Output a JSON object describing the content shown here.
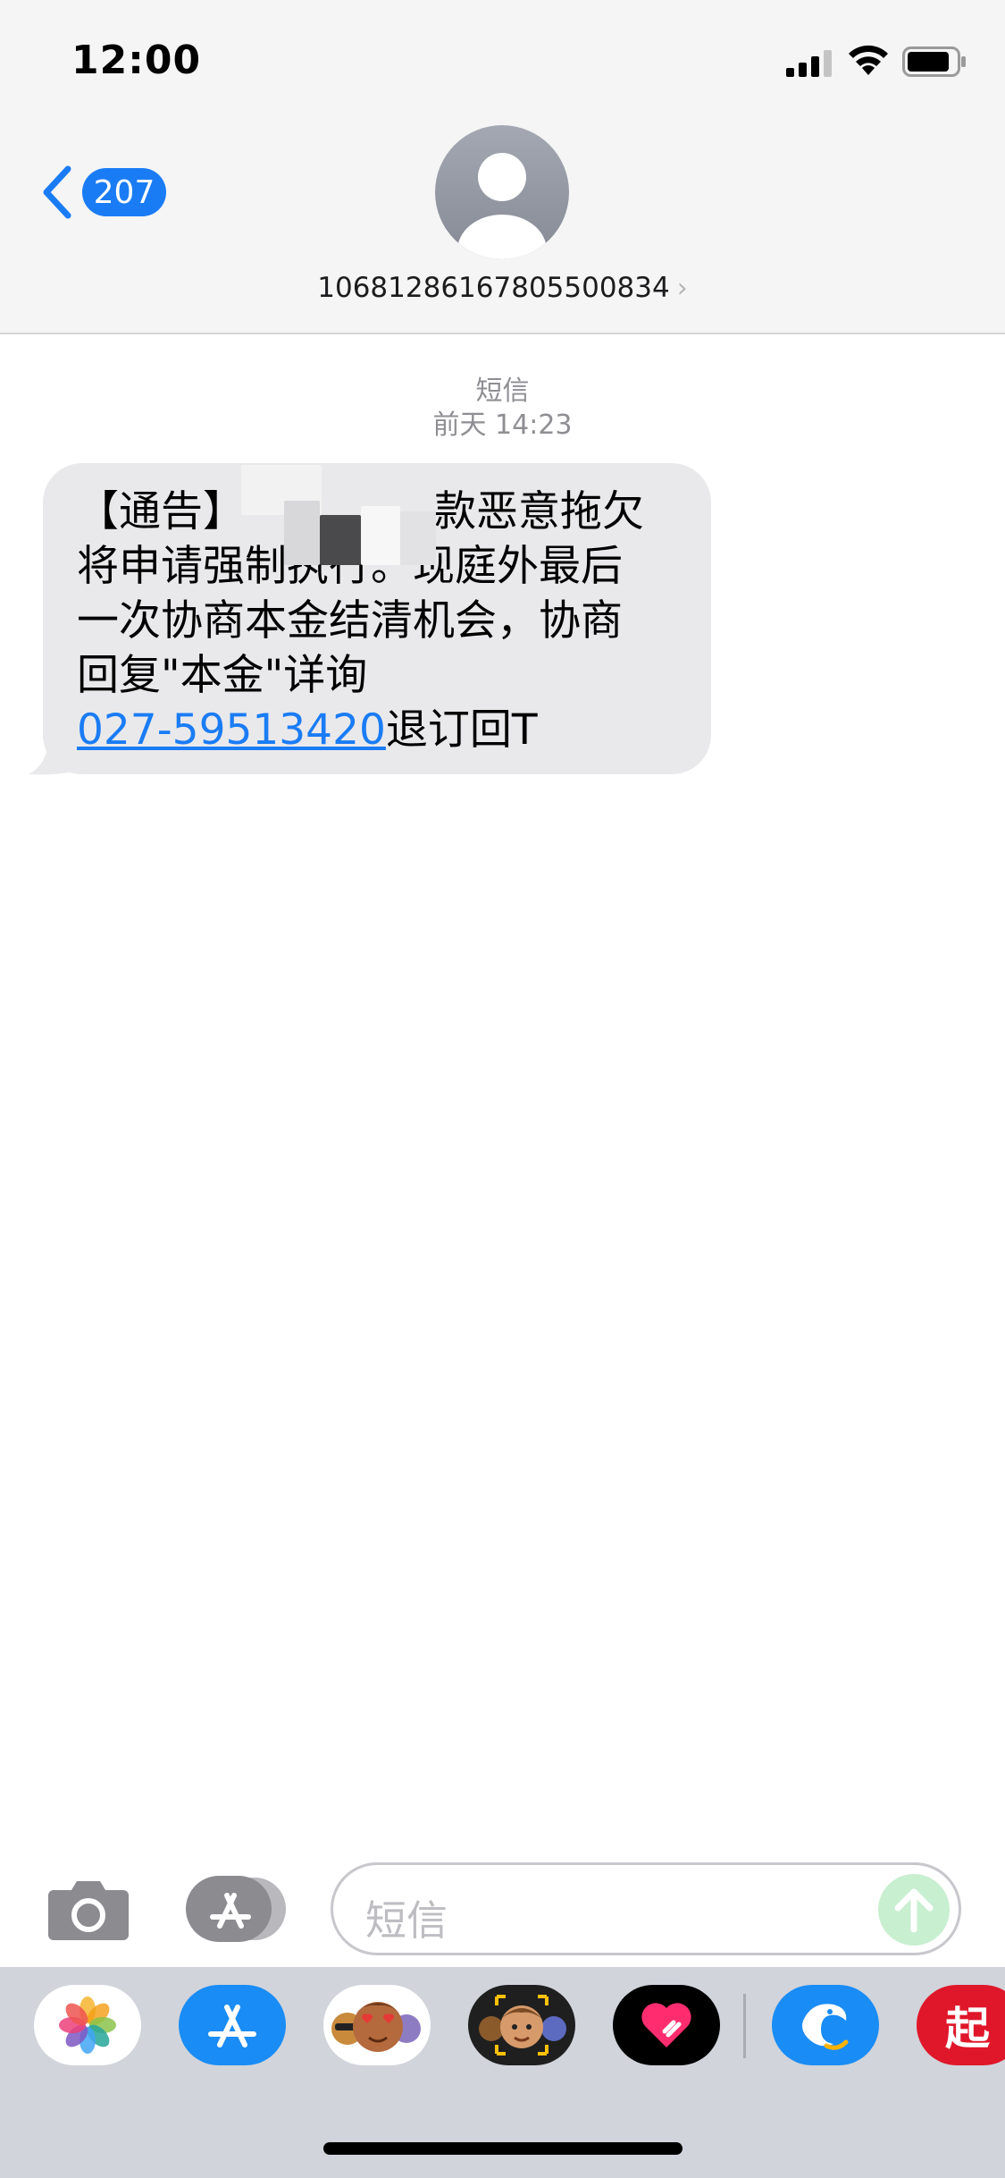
{
  "status_bar": {
    "time": "12:00"
  },
  "header": {
    "back_count": "207",
    "contact_number": "1068128616780550083 4",
    "contact_number_clean": "10681286167805500834",
    "chevron": "›"
  },
  "thread": {
    "service_label": "短信",
    "timestamp": "前天 14:23"
  },
  "message": {
    "line1_prefix": "【通告】",
    "line1_suffix": "款恶意拖欠",
    "line2": "将申请强制执行。现庭外最后",
    "line3": "一次协商本金结清机会，协商",
    "line4": "回复\"本金\"详询",
    "phone_link": "027-59513420",
    "line5_suffix": "退订回T"
  },
  "composer": {
    "placeholder": "短信"
  },
  "app_drawer": {
    "items": [
      {
        "name": "photos-app-icon"
      },
      {
        "name": "app-store-icon"
      },
      {
        "name": "memoji-stickers-icon"
      },
      {
        "name": "animoji-icon"
      },
      {
        "name": "digital-touch-icon"
      },
      {
        "name": "dolphin-app-icon"
      },
      {
        "name": "qi-app-icon",
        "glyph": "起"
      }
    ]
  },
  "colors": {
    "accent_blue": "#1a7cf5",
    "bubble_gray": "#e9e9eb",
    "header_bg": "#f5f5f5",
    "drawer_bg": "#d1d4db"
  }
}
